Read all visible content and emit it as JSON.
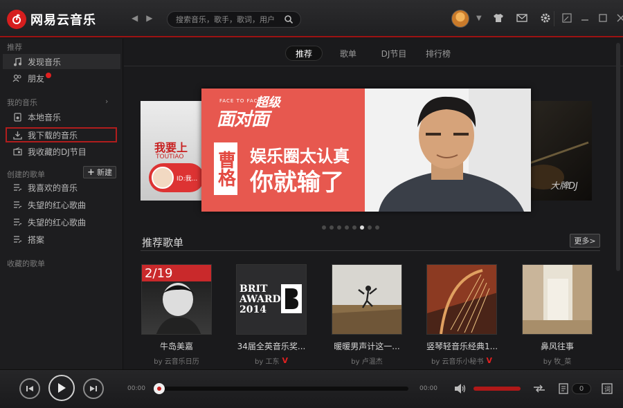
{
  "app": {
    "name": "网易云音乐"
  },
  "search": {
    "placeholder": "搜索音乐，歌手，歌词，用户"
  },
  "sidebar": {
    "recommend_header": "推荐",
    "recommend": [
      {
        "label": "发现音乐",
        "icon": "music-note-icon"
      },
      {
        "label": "朋友",
        "icon": "friends-icon"
      }
    ],
    "my_music_header": "我的音乐",
    "my_music": [
      {
        "label": "本地音乐",
        "icon": "local-music-icon"
      },
      {
        "label": "我下载的音乐",
        "icon": "download-icon"
      },
      {
        "label": "我收藏的DJ节目",
        "icon": "radio-icon"
      }
    ],
    "created_header": "创建的歌单",
    "new_button": "新建",
    "created": [
      {
        "label": "我喜欢的音乐",
        "icon": "playlist-icon"
      },
      {
        "label": "失望的红心歌曲",
        "icon": "playlist-icon"
      },
      {
        "label": "失望的红心歌曲",
        "icon": "playlist-icon"
      },
      {
        "label": "搭案",
        "icon": "playlist-icon"
      }
    ],
    "collected_header": "收藏的歌单"
  },
  "tabs": [
    {
      "label": "推荐",
      "active": true
    },
    {
      "label": "歌单",
      "active": false
    },
    {
      "label": "DJ节目",
      "active": false
    },
    {
      "label": "排行榜",
      "active": false
    }
  ],
  "banner": {
    "left_text": "我要上",
    "left_sub": "TOUTIAO",
    "left_id": "ID:我...",
    "main_kicker": "FACE TO FACE",
    "main_brand_top": "超级",
    "main_brand": "面对面",
    "main_name": "曹格",
    "main_line1": "娱乐圈太认真",
    "main_line2": "你就输了",
    "right_text": "大牌DJ",
    "dots_total": 8,
    "dots_active_index": 5
  },
  "recommended_section": {
    "title": "推荐歌单",
    "more": "更多>",
    "playlists": [
      {
        "title": "牛岛美嘉",
        "by": "by 云音乐日历",
        "v": false,
        "cover_text": "2/19"
      },
      {
        "title": "34届全英音乐奖...",
        "by": "by 工东",
        "v": true,
        "cover_text": "BRIT AWARDS 2014"
      },
      {
        "title": "暖暖男声计这一...",
        "by": "by 卢温杰",
        "v": false,
        "cover_text": ""
      },
      {
        "title": "竖琴轻音乐经典1...",
        "by": "by 云音乐小秘书",
        "v": true,
        "cover_text": ""
      },
      {
        "title": "鼻风往事",
        "by": "by 牧_菜",
        "v": false,
        "cover_text": ""
      }
    ]
  },
  "player": {
    "time_current": "00:00",
    "time_total": "00:00",
    "progress": 0,
    "volume": 1.0,
    "playlist_count": "0"
  },
  "colors": {
    "accent": "#c62f2f",
    "titlebar_line": "#9c1212",
    "banner_bg": "#e7584f"
  }
}
